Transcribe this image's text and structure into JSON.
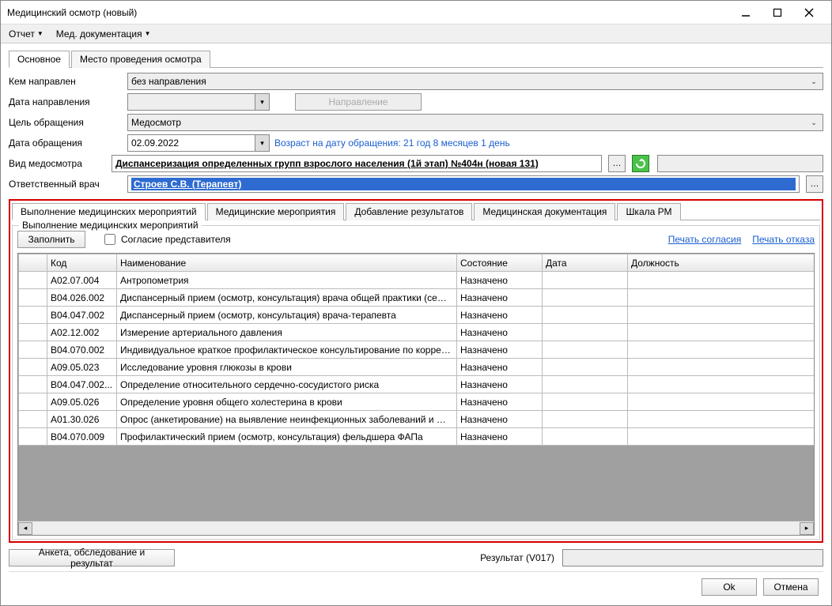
{
  "window": {
    "title": "Медицинский осмотр (новый)"
  },
  "menu": {
    "report": "Отчет",
    "docs": "Мед. документация"
  },
  "topTabs": {
    "main": "Основное",
    "place": "Место проведения осмотра"
  },
  "form": {
    "referredByLabel": "Кем направлен",
    "referredByValue": "без направления",
    "referralDateLabel": "Дата направления",
    "referralBtn": "Направление",
    "purposeLabel": "Цель обращения",
    "purposeValue": "Медосмотр",
    "visitDateLabel": "Дата обращения",
    "visitDateValue": "02.09.2022",
    "ageHint": "Возраст на дату обращения: 21 год 8 месяцев 1 день",
    "examTypeLabel": "Вид медосмотра",
    "examTypeValue": "Диспансеризация определенных групп взрослого населения (1й этап) №404н (новая 131)",
    "doctorLabel": "Ответственный врач",
    "doctorValue": "Строев С.В. (Терапевт)"
  },
  "innerTabs": {
    "exec": "Выполнение медицинских мероприятий",
    "events": "Медицинские мероприятия",
    "addResults": "Добавление результатов",
    "medDoc": "Медицинская документация",
    "scale": "Шкала РМ"
  },
  "group": {
    "title": "Выполнение медицинских мероприятий",
    "fillBtn": "Заполнить",
    "consentChk": "Согласие представителя",
    "printConsent": "Печать согласия",
    "printRefusal": "Печать отказа"
  },
  "grid": {
    "cols": {
      "code": "Код",
      "name": "Наименование",
      "state": "Состояние",
      "date": "Дата",
      "position": "Должность"
    },
    "rows": [
      {
        "code": "A02.07.004",
        "name": "Антропометрия",
        "state": "Назначено"
      },
      {
        "code": "B04.026.002",
        "name": "Диспансерный прием (осмотр, консультация) врача общей практики (семейного в...",
        "state": "Назначено"
      },
      {
        "code": "B04.047.002",
        "name": "Диспансерный прием (осмотр, консультация) врача-терапевта",
        "state": "Назначено"
      },
      {
        "code": "A02.12.002",
        "name": "Измерение артериального давления",
        "state": "Назначено"
      },
      {
        "code": "B04.070.002",
        "name": "Индивидуальное краткое профилактическое консультирование по коррекции фак...",
        "state": "Назначено"
      },
      {
        "code": "A09.05.023",
        "name": "Исследование уровня глюкозы в крови",
        "state": "Назначено"
      },
      {
        "code": "B04.047.002...",
        "name": "Определение относительного сердечно-сосудистого риска",
        "state": "Назначено"
      },
      {
        "code": "A09.05.026",
        "name": "Определение уровня общего холестерина в крови",
        "state": "Назначено"
      },
      {
        "code": "A01.30.026",
        "name": "Опрос (анкетирование) на выявление неинфекционных заболеваний и факторов р...",
        "state": "Назначено"
      },
      {
        "code": "B04.070.009",
        "name": "Профилактический прием (осмотр, консультация) фельдшера ФАПа",
        "state": "Назначено"
      }
    ]
  },
  "bottom": {
    "surveyBtn": "Анкета, обследование и результат",
    "resultLabel": "Результат (V017)",
    "ok": "Ok",
    "cancel": "Отмена"
  }
}
